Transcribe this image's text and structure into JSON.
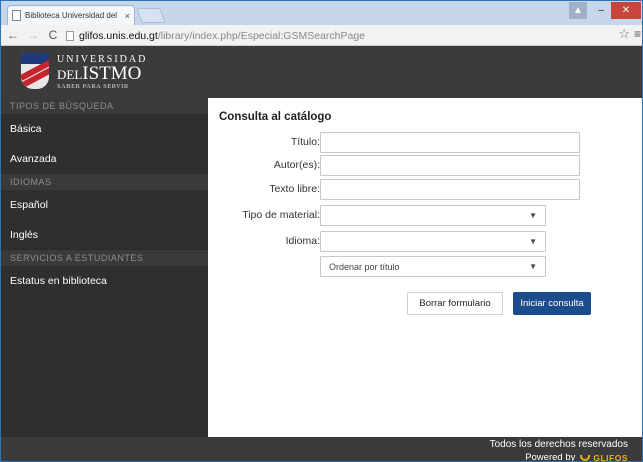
{
  "browser": {
    "tab_title": "Biblioteca Universidad del",
    "tab_close": "×",
    "url_host": "glifos.unis.edu.gt",
    "url_path": "/library/index.php/Especial:GSMSearchPage"
  },
  "header": {
    "logo_line1": "UNIVERSIDAD",
    "logo_line2_prefix": "DEL",
    "logo_line2_main": "ISTMO",
    "logo_tagline": "SABER PARA SERVIR"
  },
  "sidebar": {
    "sections": [
      {
        "title": "TIPOS DE BÚSQUEDA",
        "items": [
          "Básica",
          "Avanzada"
        ]
      },
      {
        "title": "IDIOMAS",
        "items": [
          "Español",
          "Inglés"
        ]
      },
      {
        "title": "SERVICIOS A ESTUDIANTES",
        "items": [
          "Estatus en biblioteca"
        ]
      }
    ]
  },
  "main": {
    "title": "Consulta al catálogo",
    "fields": {
      "titulo_label": "Título:",
      "autor_label": "Autor(es):",
      "texto_label": "Texto libre:",
      "tipo_label": "Tipo de material:",
      "idioma_label": "Idioma:",
      "order_value": "Ordenar por título"
    },
    "buttons": {
      "reset": "Borrar formulario",
      "search": "Iniciar consulta"
    }
  },
  "footer": {
    "rights": "Todos los derechos reservados",
    "powered_by": "Powered by",
    "brand": "GLIFOS"
  },
  "colors": {
    "header_bg": "#3b3b3b",
    "sidebar_bg": "#2f2f2f",
    "primary_button": "#1c4c8c",
    "brand_accent": "#e3b21c"
  }
}
